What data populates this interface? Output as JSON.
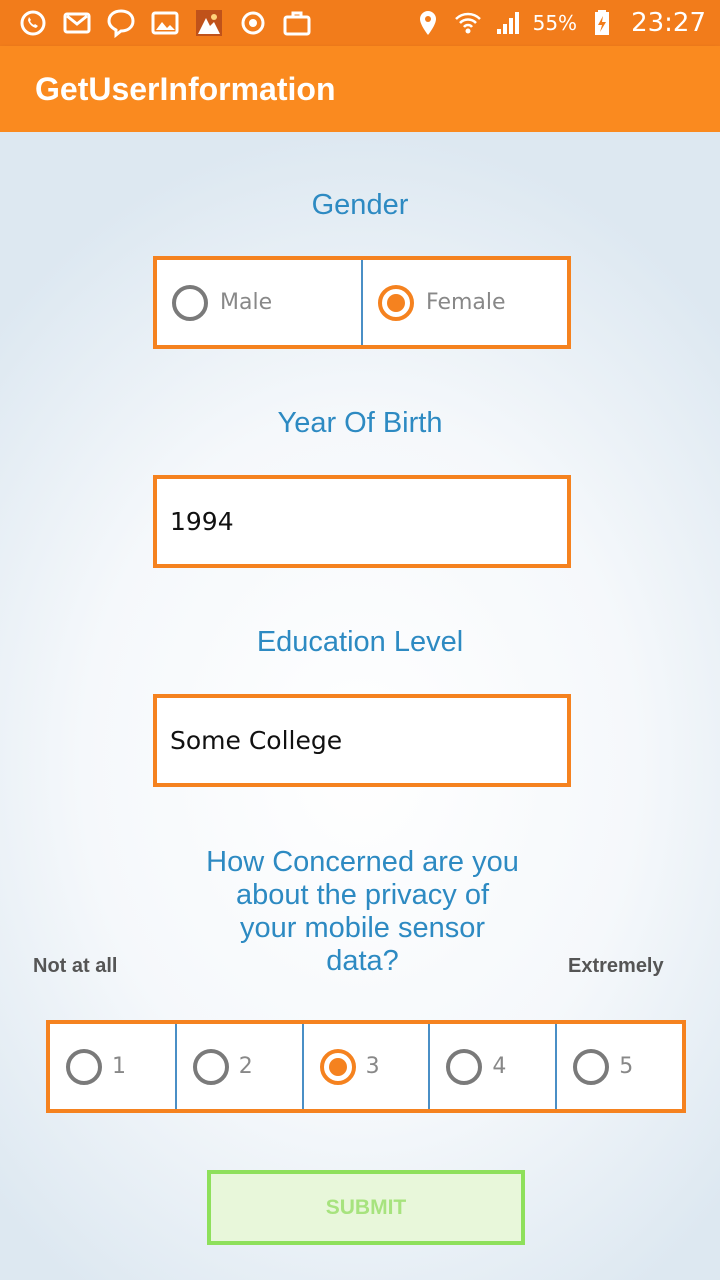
{
  "status_bar": {
    "icons_left": [
      "whatsapp-icon",
      "gmail-icon",
      "viber-icon",
      "gallery-icon",
      "photo-app-icon",
      "sync-icon",
      "briefcase-icon"
    ],
    "icons_right": [
      "location-icon",
      "wifi-icon",
      "signal-icon"
    ],
    "battery": "55%",
    "time": "23:27"
  },
  "app_bar": {
    "title": "GetUserInformation"
  },
  "gender": {
    "label": "Gender",
    "options": [
      {
        "label": "Male",
        "checked": false
      },
      {
        "label": "Female",
        "checked": true
      }
    ]
  },
  "year_of_birth": {
    "label": "Year Of Birth",
    "value": "1994"
  },
  "education": {
    "label": "Education Level",
    "value": "Some College"
  },
  "privacy": {
    "question_lines": [
      "How Concerned are you",
      "about the privacy of",
      "your mobile sensor",
      "data?"
    ],
    "low_label": "Not at all",
    "high_label": "Extremely",
    "options": [
      {
        "label": "1",
        "checked": false
      },
      {
        "label": "2",
        "checked": false
      },
      {
        "label": "3",
        "checked": true
      },
      {
        "label": "4",
        "checked": false
      },
      {
        "label": "5",
        "checked": false
      }
    ]
  },
  "submit_label": "SUBMIT",
  "colors": {
    "accent": "#f5821f",
    "label_blue": "#2d8ac2",
    "submit_border": "#8ee05b"
  }
}
